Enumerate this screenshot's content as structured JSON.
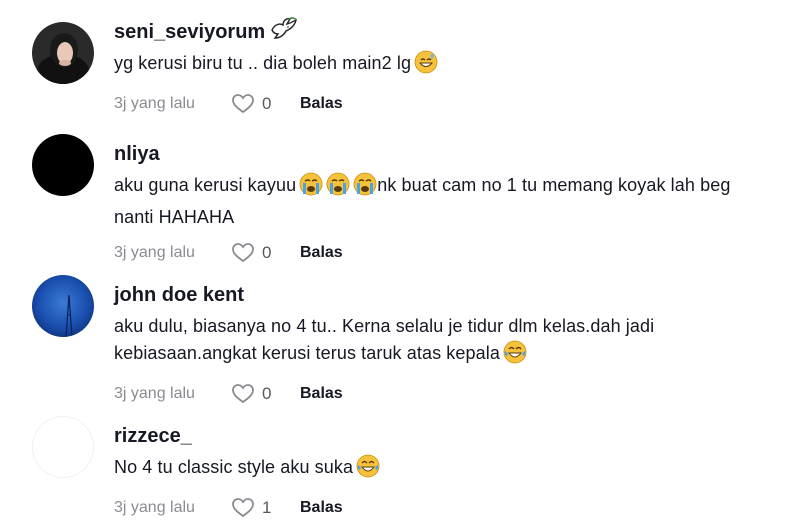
{
  "comments": [
    {
      "username": "seni_seviyorum",
      "username_emoji": "dove-icon",
      "text": "yg kerusi biru tu .. dia boleh main2 lg",
      "trailing_emoji": [
        "grinning-sweat-emoji"
      ],
      "time": "3j yang lalu",
      "likes": "0",
      "reply": "Balas"
    },
    {
      "username": "nliya",
      "text_part1": "aku guna kerusi kayuu",
      "inline_emojis": [
        "crying-face-emoji",
        "crying-face-emoji",
        "crying-face-emoji"
      ],
      "text_part2": "nk buat cam no 1 tu memang koyak lah beg",
      "text_part3": "nanti HAHAHA",
      "time": "3j yang lalu",
      "likes": "0",
      "reply": "Balas"
    },
    {
      "username": "john doe kent",
      "text_line1": "aku dulu, biasanya no 4 tu.. Kerna selalu je tidur dlm kelas.dah jadi",
      "text_line2": "kebiasaan.angkat kerusi terus taruk atas kepala",
      "trailing_emoji": [
        "tears-of-joy-emoji"
      ],
      "time": "3j yang lalu",
      "likes": "0",
      "reply": "Balas"
    },
    {
      "username": "rizzece_",
      "text": "No 4 tu classic style aku suka",
      "trailing_emoji": [
        "tears-of-joy-emoji"
      ],
      "time": "3j yang lalu",
      "likes": "1",
      "reply": "Balas"
    }
  ],
  "colors": {
    "text": "#161823",
    "muted": "#8a8b91",
    "emoji_yellow": "#f7c23b",
    "emoji_tear": "#4aa3e8"
  }
}
